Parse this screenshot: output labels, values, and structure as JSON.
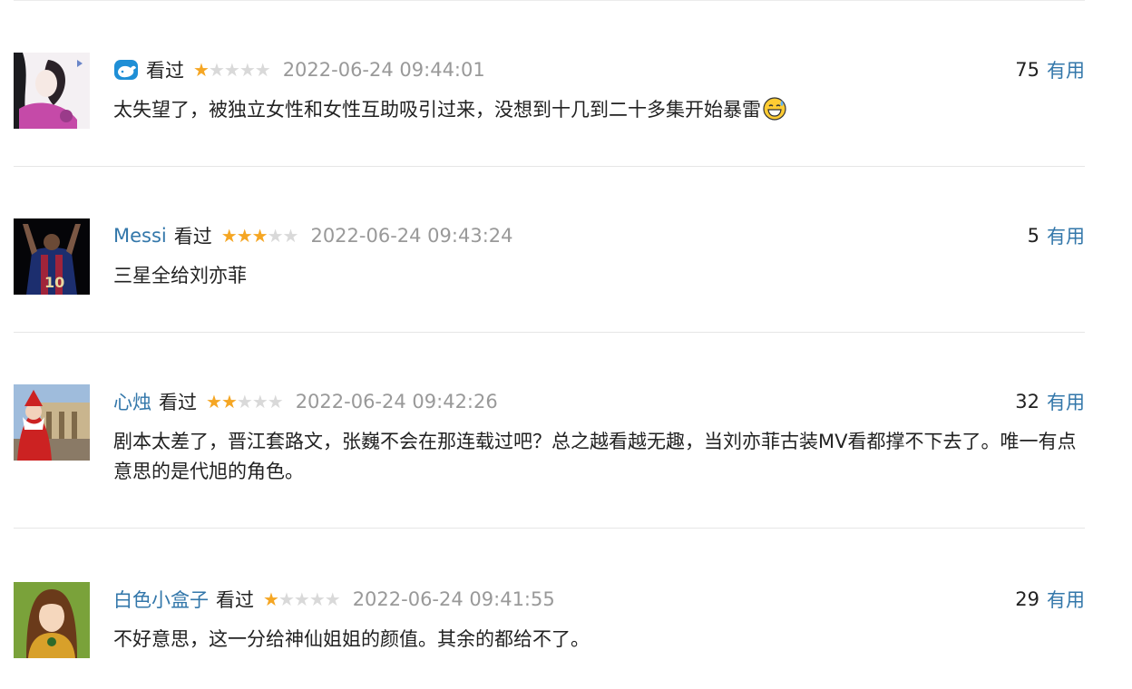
{
  "ui": {
    "watched_label": "看过",
    "useful_label": "有用"
  },
  "comments": [
    {
      "user": "",
      "user_icon": "whale-icon",
      "rating": 1,
      "rating_max": 5,
      "time": "2022-06-24 09:44:01",
      "votes": "75",
      "text": "太失望了，被独立女性和女性互助吸引过来，没想到十几到二十多集开始暴雷",
      "text_emoji": "grinning-sweat-emoji",
      "avatar": "avatar-anime-girl"
    },
    {
      "user": "Messi",
      "rating": 3,
      "rating_max": 5,
      "time": "2022-06-24 09:43:24",
      "votes": "5",
      "text": "三星全给刘亦菲",
      "avatar": "avatar-football-player"
    },
    {
      "user": "心烛",
      "rating": 2,
      "rating_max": 5,
      "time": "2022-06-24 09:42:26",
      "votes": "32",
      "text": "剧本太差了，晋江套路文，张巍不会在那连载过吧？总之越看越无趣，当刘亦菲古装MV看都撑不下去了。唯一有点意思的是代旭的角色。",
      "avatar": "avatar-santa-building"
    },
    {
      "user": "白色小盒子",
      "rating": 1,
      "rating_max": 5,
      "time": "2022-06-24 09:41:55",
      "votes": "29",
      "text": "不好意思，这一分给神仙姐姐的颜值。其余的都给不了。",
      "avatar": "avatar-cartoon-girl"
    }
  ],
  "colors": {
    "link": "#3377aa",
    "star_on": "#f5a623",
    "star_off": "#d9d9d9",
    "time": "#999999",
    "divider": "#e6e6e6"
  }
}
